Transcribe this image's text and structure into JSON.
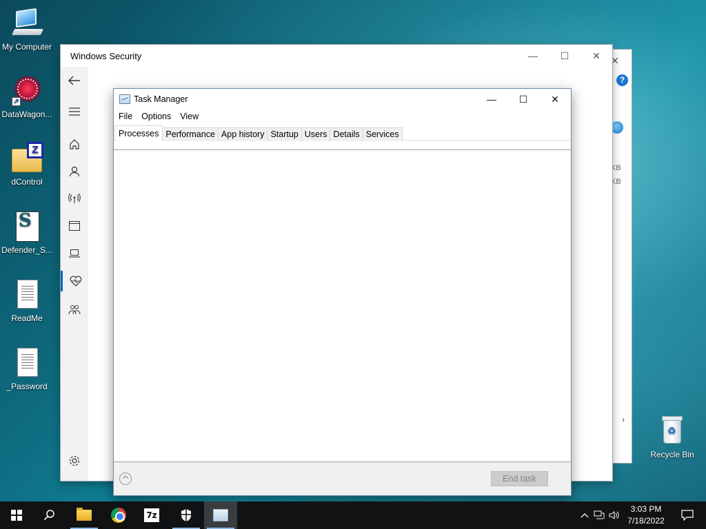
{
  "desktop": {
    "icons": [
      {
        "label": "My Computer"
      },
      {
        "label": "DataWagon..."
      },
      {
        "label": "dControl"
      },
      {
        "label": "Defender_S..."
      },
      {
        "label": "ReadMe"
      },
      {
        "label": "_Password"
      },
      {
        "label": "Recycle Bin"
      }
    ]
  },
  "security_window": {
    "title": "Windows Security",
    "controls": {
      "minimize": "—",
      "maximize": "☐",
      "close": "✕"
    },
    "sidebar_icons": [
      "back-arrow-icon",
      "hamburger-menu-icon",
      "home-icon",
      "account-icon",
      "firewall-network-icon",
      "app-browser-control-icon",
      "device-security-icon",
      "device-health-icon",
      "family-options-icon",
      "settings-gear-icon"
    ],
    "active_section": "device-health-icon"
  },
  "background_window": {
    "help_label": "?",
    "close_label": "✕",
    "kb_1": "KB",
    "kb_2": "KB",
    "scroll_arrow": "›"
  },
  "task_manager": {
    "title": "Task Manager",
    "controls": {
      "minimize": "—",
      "maximize": "☐",
      "close": "✕"
    },
    "menu": [
      "File",
      "Options",
      "View"
    ],
    "tabs": [
      "Processes",
      "Performance",
      "App history",
      "Startup",
      "Users",
      "Details",
      "Services"
    ],
    "active_tab": "Processes",
    "fewer_details_icon": "chevron-up-circle-icon",
    "end_task_label": "End task",
    "end_task_enabled": false
  },
  "taskbar": {
    "pinned": [
      "start-icon",
      "search-icon",
      "file-explorer-icon",
      "chrome-icon",
      "7zip-icon",
      "windows-security-icon",
      "task-manager-icon"
    ],
    "active_app": "task-manager-icon",
    "tray_icons": [
      "chevron-up-icon",
      "network-icon",
      "volume-icon"
    ],
    "time": "3:03 PM",
    "date": "7/18/2022",
    "notifications_icon": "action-center-icon"
  },
  "colors": {
    "accent": "#0067c0",
    "taskbar": "#101214",
    "end_task_disabled_bg": "#cccccc"
  }
}
